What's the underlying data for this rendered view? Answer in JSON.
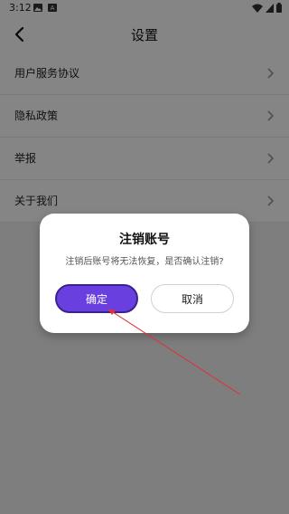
{
  "status_bar": {
    "time": "3:12"
  },
  "app_bar": {
    "title": "设置",
    "back_icon": "back-arrow-icon"
  },
  "settings": [
    {
      "label": "用户服务协议"
    },
    {
      "label": "隐私政策"
    },
    {
      "label": "举报"
    },
    {
      "label": "关于我们"
    }
  ],
  "dialog": {
    "title": "注销账号",
    "message": "注销后账号将无法恢复，是否确认注销?",
    "confirm_label": "确定",
    "cancel_label": "取消"
  },
  "colors": {
    "primary": "#6a3fe0",
    "annotation_arrow": "#e0303b"
  }
}
